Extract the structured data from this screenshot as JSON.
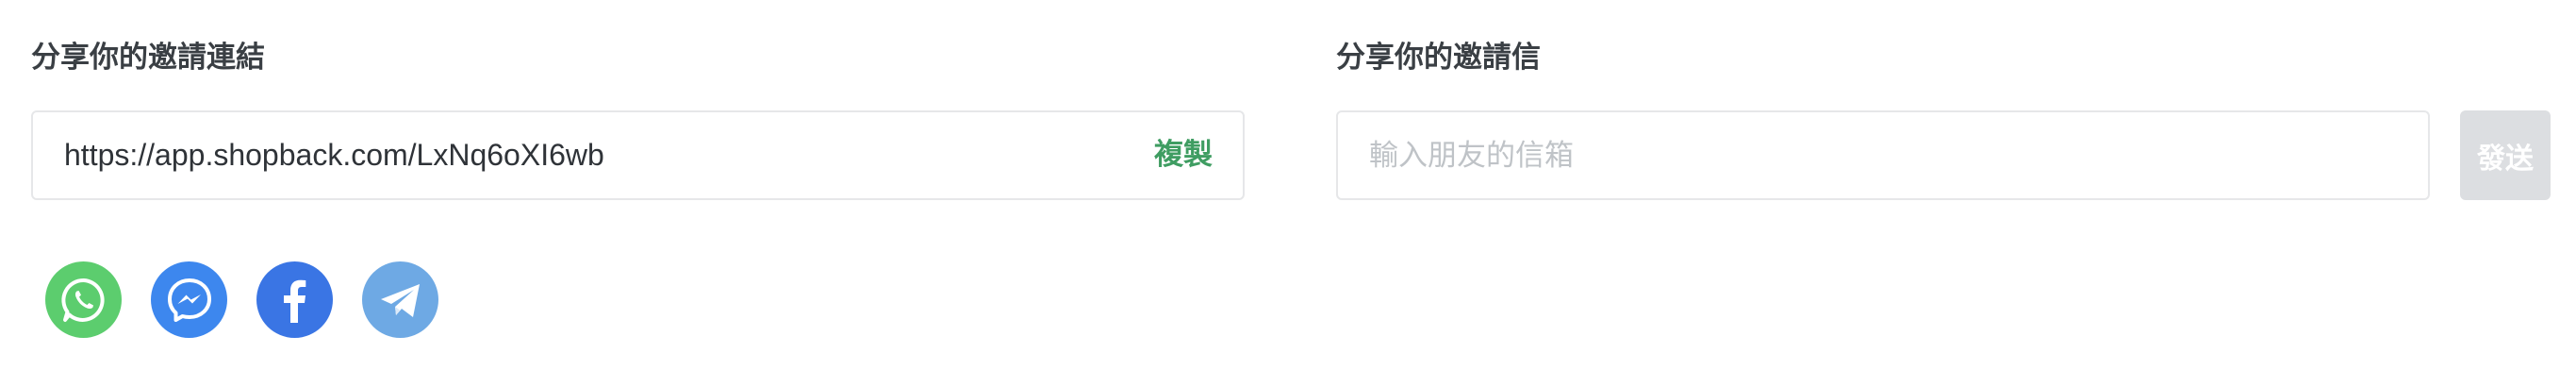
{
  "invite_link": {
    "label": "分享你的邀請連結",
    "url": "https://app.shopback.com/LxNq6oXI6wb",
    "copy_label": "複製"
  },
  "invite_email": {
    "label": "分享你的邀請信",
    "placeholder": "輸入朋友的信箱",
    "value": "",
    "send_label": "發送"
  },
  "share_buttons": [
    {
      "icon": "whatsapp-icon",
      "color": "#5ccd6e"
    },
    {
      "icon": "messenger-icon",
      "color": "#3d87ee"
    },
    {
      "icon": "facebook-icon",
      "color": "#3a75e4"
    },
    {
      "icon": "telegram-icon",
      "color": "#6ea9e4"
    }
  ],
  "colors": {
    "accent_green": "#3f9d62",
    "disabled_button": "#dcdee1",
    "border": "#e6e7e9",
    "placeholder": "#bfc3c7"
  }
}
